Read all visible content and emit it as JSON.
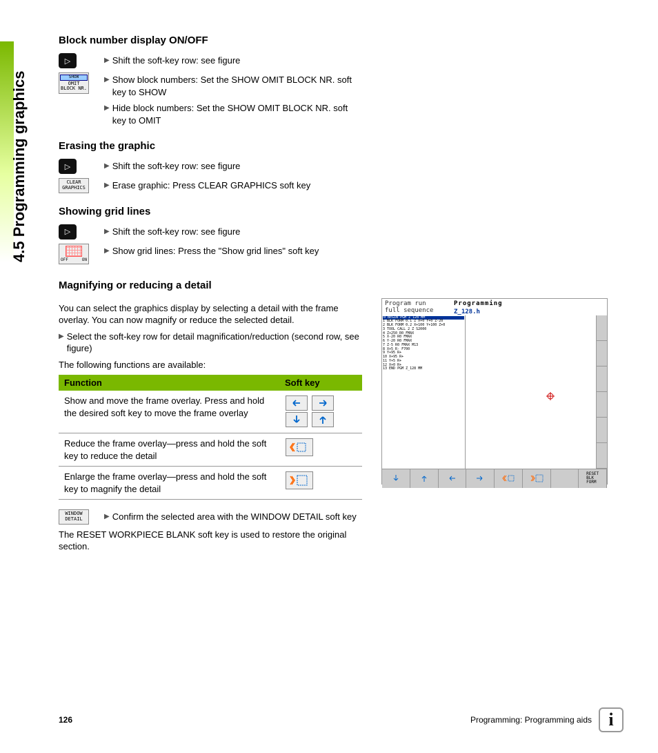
{
  "sideTitle": "4.5 Programming graphics",
  "sections": {
    "blockNumber": {
      "heading": "Block number display ON/OFF",
      "shiftBtnGlyph": "▷",
      "line1": "Shift the soft-key row: see figure",
      "softkey": {
        "top": "SHOW",
        "mid": "OMIT",
        "bot": "BLOCK NR."
      },
      "line2": "Show block numbers: Set the SHOW OMIT BLOCK NR. soft key to SHOW",
      "line3": "Hide block numbers: Set the SHOW OMIT BLOCK NR. soft key to OMIT"
    },
    "erase": {
      "heading": "Erasing the graphic",
      "line1": "Shift the soft-key row: see figure",
      "softkey": {
        "l1": "CLEAR",
        "l2": "GRAPHICS"
      },
      "line2": "Erase graphic: Press CLEAR GRAPHICS soft key"
    },
    "grid": {
      "heading": "Showing grid lines",
      "line1": "Shift the soft-key row: see figure",
      "softkey": {
        "off": "OFF",
        "on": "ON"
      },
      "line2": "Show grid lines: Press the \"Show grid lines\" soft key"
    },
    "magnify": {
      "heading": "Magnifying or reducing a detail",
      "para1": "You can select the graphics display by selecting a detail with the frame overlay. You can now magnify or reduce the selected detail.",
      "bullet1": "Select the soft-key row for detail magnification/reduction (second row, see figure)",
      "para2": "The following functions are available:",
      "table": {
        "col1": "Function",
        "col2": "Soft key",
        "r1": "Show and move the frame overlay. Press and hold the desired soft key to move the frame overlay",
        "r2": "Reduce the frame overlay—press and hold the soft key to reduce the detail",
        "r3": "Enlarge the frame overlay—press and hold the soft key to magnify the detail"
      },
      "confirm": {
        "softkey": {
          "l1": "WINDOW",
          "l2": "DETAIL"
        },
        "text": "Confirm the selected area with the WINDOW DETAIL soft key"
      },
      "para3": "The RESET WORKPIECE BLANK soft key is used to restore the original section."
    }
  },
  "screenshot": {
    "hdrL1": "Program run",
    "hdrL2": "full sequence",
    "hdrTitle": "Programming",
    "hdrFile": "Z_128.h",
    "listHi": "0  BEGIN PGM Z_128 MM",
    "lines": [
      "1  BLK FORM 0.1 Z X+0 Y+0 Z-20",
      "2  BLK FORM 0.2  X+100 Y+100  Z+0",
      "3  TOOL CALL 2 Z S2000",
      "4   Z+250 R0 FMAX",
      "5   X-20 R0 FMAX",
      "6   Y-20 R0 FMAX",
      "7   Z-5 R0 FMAX M13",
      "8   X+5 R- F700",
      "9   Y+95 R+",
      "10  X+95 R+",
      "11  Y+5 R+",
      "12  X+0 R+",
      "13 END PGM Z_128 MM"
    ],
    "bottomReset": "RESET\nBLK\nFORM"
  },
  "footer": {
    "page": "126",
    "chapter": "Programming: Programming aids"
  }
}
